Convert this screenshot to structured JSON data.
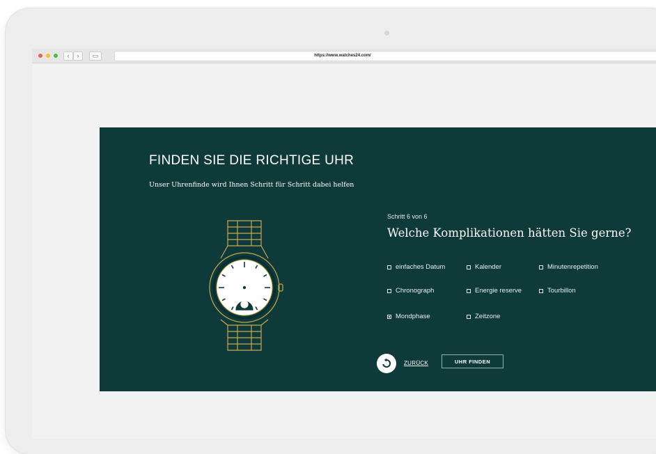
{
  "browser": {
    "url": "https://www.watches24.com/"
  },
  "hero": {
    "title": "FINDEN SIE DIE RICHTIGE UHR",
    "subtitle": "Unser Uhrenfinde wird Ihnen Schritt für Schritt dabei helfen"
  },
  "wizard": {
    "step": "Schritt 6 von 6",
    "question": "Welche Komplikationen hätten Sie gerne?",
    "options": [
      {
        "label": "einfaches Datum",
        "checked": false
      },
      {
        "label": "Kalender",
        "checked": false
      },
      {
        "label": "Minutenrepetition",
        "checked": false
      },
      {
        "label": "Chronograph",
        "checked": false
      },
      {
        "label": "Energie reserve",
        "checked": false
      },
      {
        "label": "Tourbillon",
        "checked": false
      },
      {
        "label": "Mondphase",
        "checked": true
      },
      {
        "label": "Zeitzone",
        "checked": false
      }
    ],
    "back_label": "ZURÜCK",
    "submit_label": "UHR FINDEN"
  },
  "colors": {
    "panel": "#0e3a3a",
    "watch_outline": "#c9a94e",
    "window_red": "#f25d52",
    "window_yellow": "#f7bd3a",
    "window_green": "#3ec248"
  },
  "icons": [
    "back-arrow-icon",
    "forward-arrow-icon",
    "sidebar-icon",
    "reset-icon",
    "watch-illustration"
  ]
}
